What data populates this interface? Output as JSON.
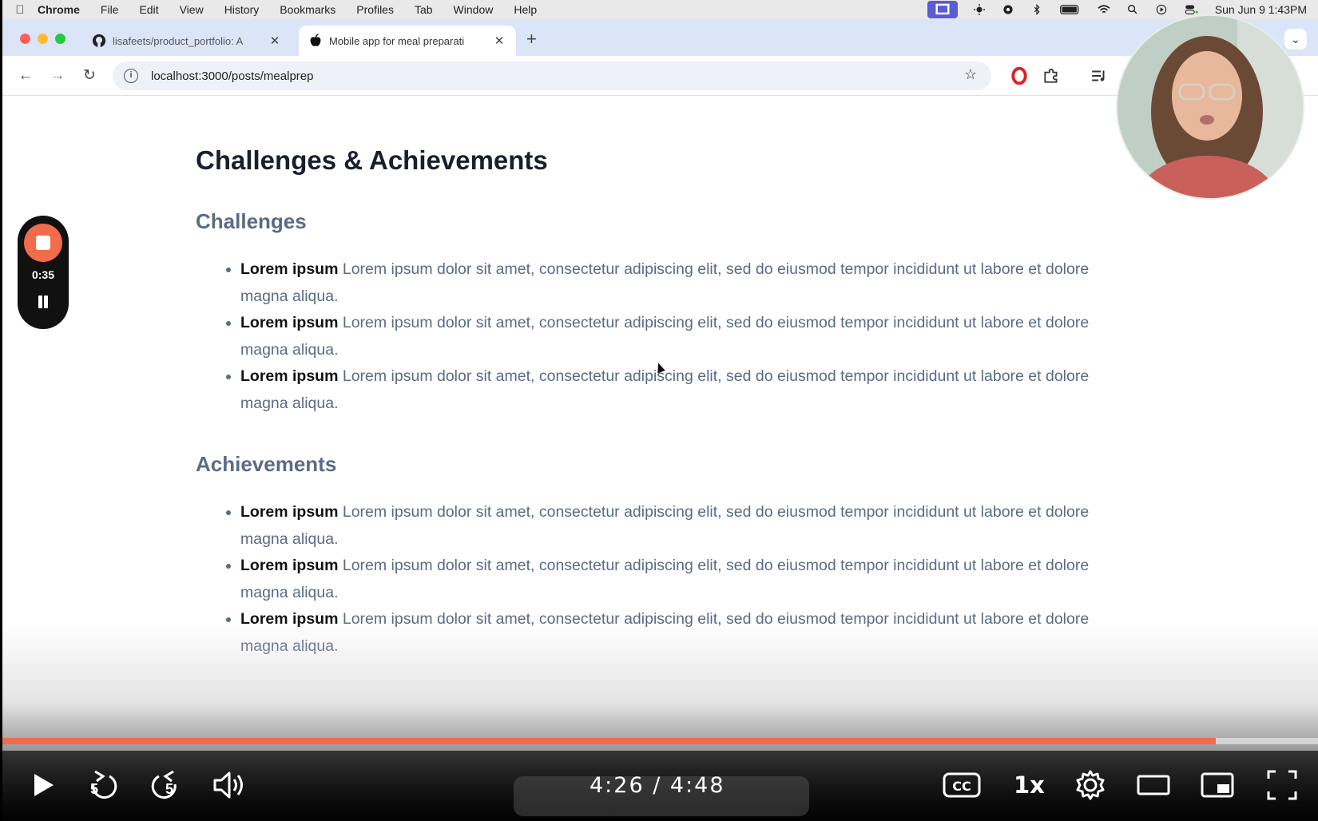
{
  "menubar": {
    "app_name": "Chrome",
    "items": [
      "File",
      "Edit",
      "View",
      "History",
      "Bookmarks",
      "Profiles",
      "Tab",
      "Window",
      "Help"
    ],
    "clock": "Sun Jun 9  1:43PM"
  },
  "tabs": [
    {
      "title": "lisafeets/product_portfolio: A",
      "favicon": "github-icon"
    },
    {
      "title": "Mobile app for meal preparati",
      "favicon": "apple-icon"
    }
  ],
  "address_bar": {
    "url": "localhost:3000/posts/mealprep"
  },
  "page": {
    "title": "Challenges & Achievements",
    "challenges": {
      "heading": "Challenges",
      "items": [
        {
          "lead": "Lorem ipsum",
          "text": "Lorem ipsum dolor sit amet, consectetur adipiscing elit, sed do eiusmod tempor incididunt ut labore et dolore magna aliqua."
        },
        {
          "lead": "Lorem ipsum",
          "text": "Lorem ipsum dolor sit amet, consectetur adipiscing elit, sed do eiusmod tempor incididunt ut labore et dolore magna aliqua."
        },
        {
          "lead": "Lorem ipsum",
          "text": "Lorem ipsum dolor sit amet, consectetur adipiscing elit, sed do eiusmod tempor incididunt ut labore et dolore magna aliqua."
        }
      ]
    },
    "achievements": {
      "heading": "Achievements",
      "items": [
        {
          "lead": "Lorem ipsum",
          "text": "Lorem ipsum dolor sit amet, consectetur adipiscing elit, sed do eiusmod tempor incididunt ut labore et dolore magna aliqua."
        },
        {
          "lead": "Lorem ipsum",
          "text": "Lorem ipsum dolor sit amet, consectetur adipiscing elit, sed do eiusmod tempor incididunt ut labore et dolore magna aliqua."
        },
        {
          "lead": "Lorem ipsum",
          "text": "Lorem ipsum dolor sit amet, consectetur adipiscing elit, sed do eiusmod tempor incididunt ut labore et dolore magna aliqua."
        }
      ]
    }
  },
  "recorder": {
    "elapsed": "0:35"
  },
  "player": {
    "time_display": "4:26 / 4:48",
    "progress_fraction": 0.922,
    "speed": "1x",
    "rewind_seconds": "5",
    "forward_seconds": "5"
  },
  "colors": {
    "accent": "#f26b4b",
    "heading": "#1a1f2e",
    "subheading": "#5b6b86",
    "tabbar": "#dce5f7"
  }
}
